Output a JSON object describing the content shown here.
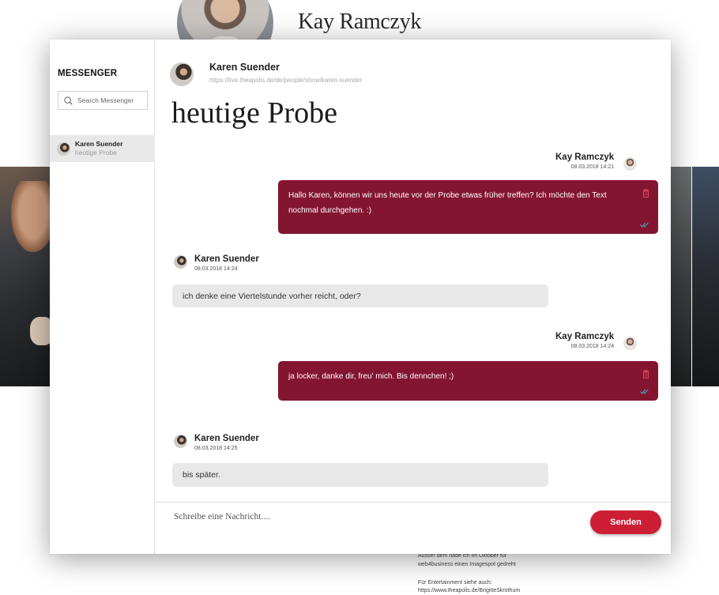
{
  "background_page": {
    "profile_name": "Kay Ramczyk",
    "text_lines": [
      "Ausser dem habe ich im Oktober für",
      "web4business einen Imagespot gedreht",
      "",
      "Für Entertainment siehe auch:",
      "https://www.theapolis.de/BrigitteSkrothum"
    ]
  },
  "messenger": {
    "sidebar": {
      "title": "MESSENGER",
      "search_placeholder": "Search Messenger",
      "conversations": [
        {
          "name": "Karen Suender",
          "preview": "heutige Probe"
        }
      ]
    },
    "header": {
      "contact_name": "Karen Suender",
      "profile_url": "https://live.theapolis.de/de/people/show/karen-suender"
    },
    "conversation_title": "heutige Probe",
    "messages": [
      {
        "direction": "out",
        "author": "Kay Ramczyk",
        "time": "08.03.2018 14:21",
        "text": "Hallo Karen, können wir uns heute vor der Probe etwas früher treffen? Ich möchte den Text nochmal durchgehen. :)"
      },
      {
        "direction": "in",
        "author": "Karen Suender",
        "time": "08.03.2018 14:24",
        "text": "ich denke eine Viertelstunde vorher reicht, oder?"
      },
      {
        "direction": "out",
        "author": "Kay Ramczyk",
        "time": "08.03.2018 14:24",
        "text": "ja locker, danke dir, freu' mich. Bis dennchen! ;)"
      },
      {
        "direction": "in",
        "author": "Karen Suender",
        "time": "08.03.2018 14:25",
        "text": "bis später."
      }
    ],
    "composer": {
      "placeholder": "Schreibe eine Nachricht....",
      "send_label": "Senden"
    },
    "colors": {
      "outgoing_bubble": "#831530",
      "incoming_bubble": "#e8e8e8",
      "send_button": "#cc1f36",
      "read_check": "#4f9bb0"
    },
    "icons": [
      "search-icon",
      "trash-icon",
      "read-check-icon"
    ]
  }
}
